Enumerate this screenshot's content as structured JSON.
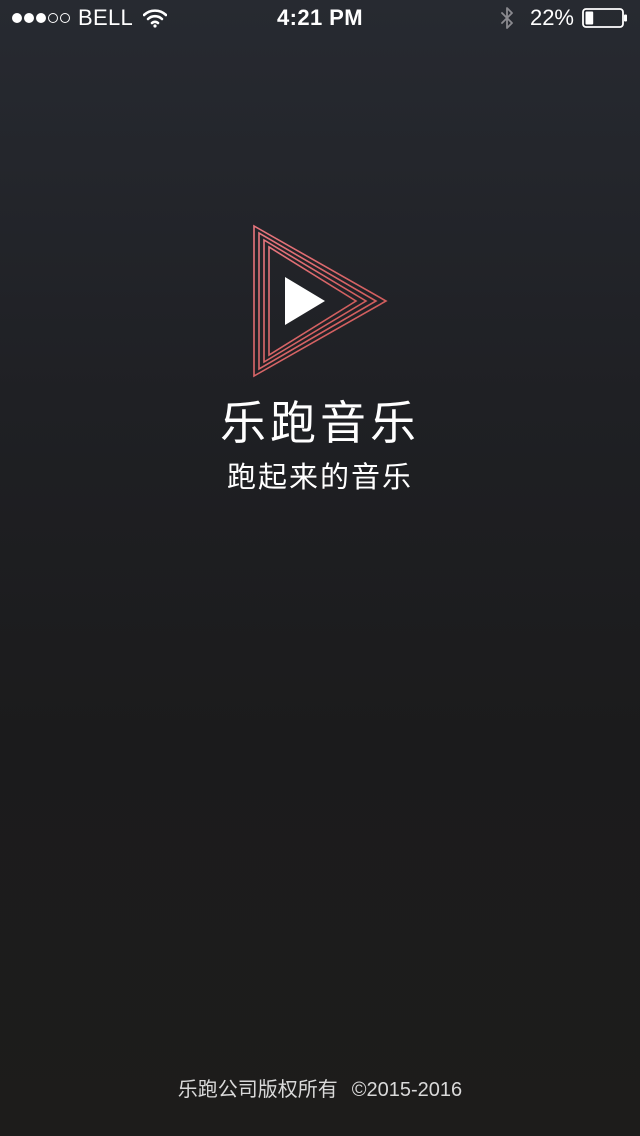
{
  "status_bar": {
    "carrier": "BELL",
    "time": "4:21 PM",
    "battery_percent_text": "22%",
    "battery_level": 0.22,
    "signal_strength": 3,
    "signal_max": 5
  },
  "splash": {
    "title": "乐跑音乐",
    "slogan": "跑起来的音乐"
  },
  "footer": {
    "company_rights": "乐跑公司版权所有",
    "copyright": "©2015-2016"
  },
  "colors": {
    "background_top": "#272a31",
    "background_bottom": "#1d1c1b",
    "logo_gradient_start": "#e8767e",
    "logo_gradient_end": "#c95552",
    "text": "#ffffff"
  },
  "icons": {
    "wifi": "wifi-icon",
    "bluetooth": "bluetooth-icon",
    "battery": "battery-icon",
    "logo": "play-triangle-logo-icon"
  }
}
